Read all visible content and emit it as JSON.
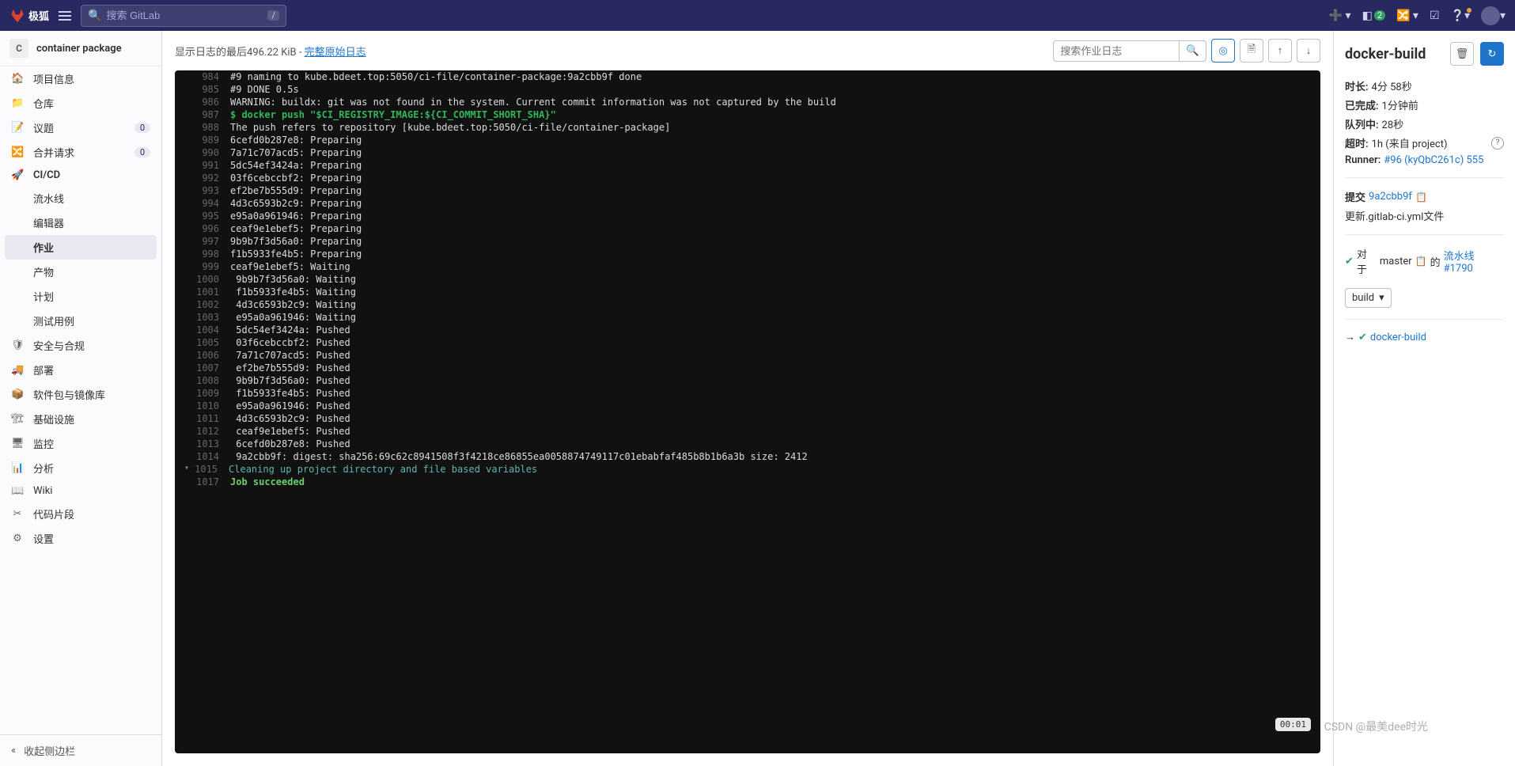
{
  "topbar": {
    "brand": "极狐",
    "search_placeholder": "搜索 GitLab",
    "search_kbd": "/",
    "mr_count": "2"
  },
  "sidebar": {
    "project_initial": "C",
    "project_name": "container package",
    "items": [
      {
        "icon": "🏠",
        "label": "项目信息"
      },
      {
        "icon": "📁",
        "label": "仓库"
      },
      {
        "icon": "📝",
        "label": "议题",
        "badge": "0"
      },
      {
        "icon": "🔀",
        "label": "合并请求",
        "badge": "0"
      },
      {
        "icon": "🚀",
        "label": "CI/CD",
        "bold": true
      },
      {
        "sub": true,
        "label": "流水线"
      },
      {
        "sub": true,
        "label": "编辑器"
      },
      {
        "sub": true,
        "label": "作业",
        "active": true
      },
      {
        "sub": true,
        "label": "产物"
      },
      {
        "sub": true,
        "label": "计划"
      },
      {
        "sub": true,
        "label": "测试用例"
      },
      {
        "icon": "🛡",
        "label": "安全与合规"
      },
      {
        "icon": "🚚",
        "label": "部署"
      },
      {
        "icon": "📦",
        "label": "软件包与镜像库"
      },
      {
        "icon": "🏗",
        "label": "基础设施"
      },
      {
        "icon": "🖥",
        "label": "监控"
      },
      {
        "icon": "📊",
        "label": "分析"
      },
      {
        "icon": "📖",
        "label": "Wiki"
      },
      {
        "icon": "✂",
        "label": "代码片段"
      },
      {
        "icon": "⚙",
        "label": "设置"
      }
    ],
    "collapse": "收起侧边栏"
  },
  "log_header": {
    "prefix": "显示日志的最后",
    "size": "496.22 KiB",
    "dash": " - ",
    "link": "完整原始日志",
    "search_placeholder": "搜索作业日志"
  },
  "log_lines": [
    {
      "n": 984,
      "t": "#9 naming to kube.bdeet.top:5050/ci-file/container-package:9a2cbb9f done"
    },
    {
      "n": 985,
      "t": "#9 DONE 0.5s"
    },
    {
      "n": 986,
      "t": "WARNING: buildx: git was not found in the system. Current commit information was not captured by the build"
    },
    {
      "n": 987,
      "t": "$ docker push \"$CI_REGISTRY_IMAGE:${CI_COMMIT_SHORT_SHA}\"",
      "c": "ln-cmd"
    },
    {
      "n": 988,
      "t": "The push refers to repository [kube.bdeet.top:5050/ci-file/container-package]"
    },
    {
      "n": 989,
      "t": "6cefd0b287e8: Preparing"
    },
    {
      "n": 990,
      "t": "7a71c707acd5: Preparing"
    },
    {
      "n": 991,
      "t": "5dc54ef3424a: Preparing"
    },
    {
      "n": 992,
      "t": "03f6cebccbf2: Preparing"
    },
    {
      "n": 993,
      "t": "ef2be7b555d9: Preparing"
    },
    {
      "n": 994,
      "t": "4d3c6593b2c9: Preparing"
    },
    {
      "n": 995,
      "t": "e95a0a961946: Preparing"
    },
    {
      "n": 996,
      "t": "ceaf9e1ebef5: Preparing"
    },
    {
      "n": 997,
      "t": "9b9b7f3d56a0: Preparing"
    },
    {
      "n": 998,
      "t": "f1b5933fe4b5: Preparing"
    },
    {
      "n": 999,
      "t": "ceaf9e1ebef5: Waiting"
    },
    {
      "n": 1000,
      "t": " 9b9b7f3d56a0: Waiting"
    },
    {
      "n": 1001,
      "t": " f1b5933fe4b5: Waiting"
    },
    {
      "n": 1002,
      "t": " 4d3c6593b2c9: Waiting"
    },
    {
      "n": 1003,
      "t": " e95a0a961946: Waiting"
    },
    {
      "n": 1004,
      "t": " 5dc54ef3424a: Pushed"
    },
    {
      "n": 1005,
      "t": " 03f6cebccbf2: Pushed"
    },
    {
      "n": 1006,
      "t": " 7a71c707acd5: Pushed"
    },
    {
      "n": 1007,
      "t": " ef2be7b555d9: Pushed"
    },
    {
      "n": 1008,
      "t": " 9b9b7f3d56a0: Pushed"
    },
    {
      "n": 1009,
      "t": " f1b5933fe4b5: Pushed"
    },
    {
      "n": 1010,
      "t": " e95a0a961946: Pushed"
    },
    {
      "n": 1011,
      "t": " 4d3c6593b2c9: Pushed"
    },
    {
      "n": 1012,
      "t": " ceaf9e1ebef5: Pushed"
    },
    {
      "n": 1013,
      "t": " 6cefd0b287e8: Pushed"
    },
    {
      "n": 1014,
      "t": " 9a2cbb9f: digest: sha256:69c62c8941508f3f4218ce86855ea0058874749117c01ebabfaf485b8b1b6a3b size: 2412"
    },
    {
      "n": 1015,
      "t": "Cleaning up project directory and file based variables",
      "c": "ln-teal",
      "chev": true,
      "timer": "00:01"
    },
    {
      "n": 1017,
      "t": "Job succeeded",
      "c": "ln-bgreen"
    }
  ],
  "right": {
    "title": "docker-build",
    "duration_label": "时长:",
    "duration": "4分 58秒",
    "finished_label": "已完成:",
    "finished": "1分钟前",
    "queued_label": "队列中:",
    "queued": "28秒",
    "timeout_label": "超时:",
    "timeout": "1h (来自 project)",
    "runner_label": "Runner:",
    "runner": "#96 (kyQbC261c) 555",
    "commit_label": "提交",
    "commit": "9a2cbb9f",
    "commit_msg": "更新.gitlab-ci.yml文件",
    "pipeline_pre": "对于",
    "branch": "master",
    "pipeline_mid": "的",
    "pipeline_link": "流水线 #1790",
    "stage": "build",
    "job_link": "docker-build"
  },
  "watermark": "CSDN @最美dee时光"
}
